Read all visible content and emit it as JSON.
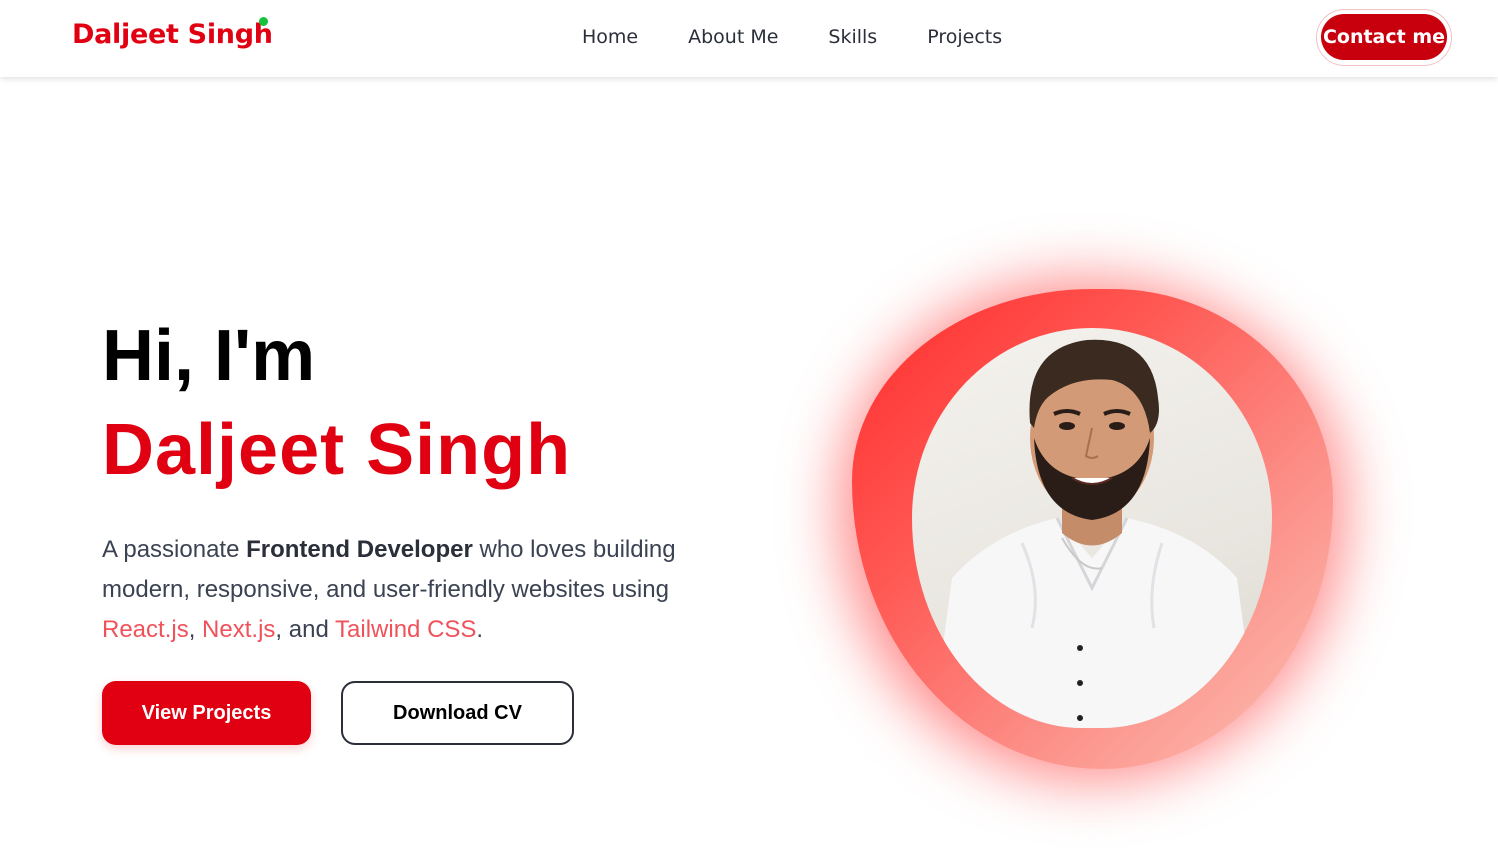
{
  "nav": {
    "brand": "Daljeet Singh",
    "links": [
      "Home",
      "About Me",
      "Skills",
      "Projects"
    ],
    "contact_label": "Contact me"
  },
  "hero": {
    "greeting": "Hi, I'm",
    "name": "Daljeet Singh",
    "desc_start": "A passionate ",
    "desc_role": "Frontend Developer",
    "desc_mid": " who loves building modern, responsive, and user-friendly websites using ",
    "tech_1": "React.js",
    "sep_1": ", ",
    "tech_2": "Next.js",
    "sep_2": ", and ",
    "tech_3": "Tailwind CSS",
    "desc_end": ".",
    "btn_projects": "View Projects",
    "btn_cv": "Download CV"
  },
  "colors": {
    "accent": "#e00011",
    "online": "#16c23c",
    "tech_highlight": "#f0525b"
  }
}
